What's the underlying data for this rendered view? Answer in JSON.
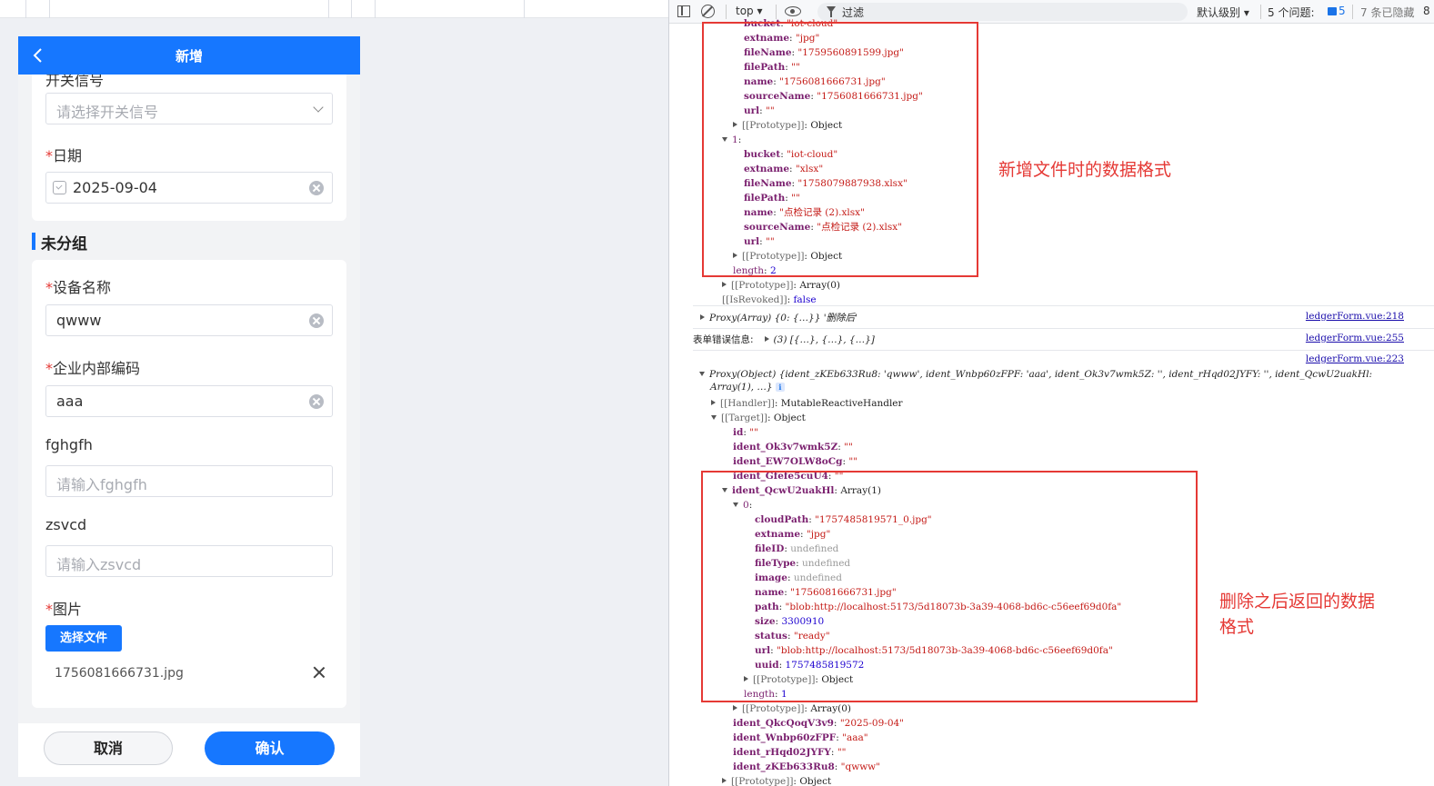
{
  "form": {
    "nav_title": "新增",
    "switch_label_partial": "开关信号",
    "switch_placeholder": "请选择开关信号",
    "date_label": "日期",
    "date_value": "2025-09-04",
    "group_title": "未分组",
    "device_name_label": "设备名称",
    "device_name_value": "qwww",
    "code_label": "企业内部编码",
    "code_value": "aaa",
    "field3_label": "fghgfh",
    "field3_placeholder": "请输入fghgfh",
    "field4_label": "zsvcd",
    "field4_placeholder": "请输入zsvcd",
    "image_label": "图片",
    "upload_label": "选择文件",
    "file_name": "1756081666731.jpg",
    "required_mark": "*",
    "cancel_label": "取消",
    "confirm_label": "确认"
  },
  "devtools": {
    "context": "top ▾",
    "filter_placeholder": "过滤",
    "level": "默认级别 ▾",
    "issues": "5 个问题:",
    "issues_count": "5",
    "hidden": "7 条已隐藏",
    "hidden_tail": "8"
  },
  "console": {
    "block1": [
      {
        "t": "bucket",
        "v": "\"iot-cloud\""
      },
      {
        "t": "extname",
        "v": "\"jpg\""
      },
      {
        "t": "fileName",
        "v": "\"1759560891599.jpg\""
      },
      {
        "t": "filePath",
        "v": "\"\""
      },
      {
        "t": "name",
        "v": "\"1756081666731.jpg\""
      },
      {
        "t": "sourceName",
        "v": "\"1756081666731.jpg\""
      },
      {
        "t": "url",
        "v": "\"\""
      },
      {
        "t": "[[Prototype]]",
        "v": "Object"
      },
      {
        "t": "1",
        "v": ""
      },
      {
        "t": "bucket",
        "v": "\"iot-cloud\""
      },
      {
        "t": "extname",
        "v": "\"xlsx\""
      },
      {
        "t": "fileName",
        "v": "\"1758079887938.xlsx\""
      },
      {
        "t": "filePath",
        "v": "\"\""
      },
      {
        "t": "name",
        "v": "\"点检记录 (2).xlsx\""
      },
      {
        "t": "sourceName",
        "v": "\"点检记录 (2).xlsx\""
      },
      {
        "t": "url",
        "v": "\"\""
      },
      {
        "t": "[[Prototype]]",
        "v": "Object"
      },
      {
        "t": "length",
        "v": "2"
      },
      {
        "t": "[[Prototype]]",
        "v": "Array(0)"
      },
      {
        "t": "[[IsRevoked]]",
        "v": "false"
      }
    ],
    "msg2_text": "Proxy(Array) {0: {…}} '删除后'",
    "msg2_link": "ledgerForm.vue:218",
    "msg3_label": "表单错误信息:",
    "msg3_text": "(3) [{…}, {…}, {…}]",
    "msg3_link": "ledgerForm.vue:255",
    "msg4_link": "ledgerForm.vue:223",
    "msg4_head": "Proxy(Object) {ident_zKEb633Ru8: 'qwww', ident_Wnbp60zFPF: 'aaa', ident_Ok3v7wmk5Z: '', ident_rHqd02JYFY: '', ident_QcwU2uakHl:",
    "msg4_head2": "Array(1), …}",
    "block2": [
      {
        "t": "[[Handler]]",
        "v": "MutableReactiveHandler"
      },
      {
        "t": "[[Target]]",
        "v": "Object"
      },
      {
        "t": "id",
        "v": "\"\""
      },
      {
        "t": "ident_Ok3v7wmk5Z",
        "v": "\"\""
      },
      {
        "t": "ident_EW7OLW8oCg",
        "v": "\"\""
      },
      {
        "t": "ident_Gfefe5cuU4",
        "v": "\"\""
      },
      {
        "t": "ident_QcwU2uakHl",
        "v": "Array(1)"
      },
      {
        "t": "0",
        "v": ""
      },
      {
        "t": "cloudPath",
        "v": "\"1757485819571_0.jpg\""
      },
      {
        "t": "extname",
        "v": "\"jpg\""
      },
      {
        "t": "fileID",
        "v": "undefined"
      },
      {
        "t": "fileType",
        "v": "undefined"
      },
      {
        "t": "image",
        "v": "undefined"
      },
      {
        "t": "name",
        "v": "\"1756081666731.jpg\""
      },
      {
        "t": "path",
        "v": "\"blob:http://localhost:5173/5d18073b-3a39-4068-bd6c-c56eef69d0fa\""
      },
      {
        "t": "size",
        "v": "3300910"
      },
      {
        "t": "status",
        "v": "\"ready\""
      },
      {
        "t": "url",
        "v": "\"blob:http://localhost:5173/5d18073b-3a39-4068-bd6c-c56eef69d0fa\""
      },
      {
        "t": "uuid",
        "v": "1757485819572"
      },
      {
        "t": "[[Prototype]]",
        "v": "Object"
      },
      {
        "t": "length",
        "v": "1"
      },
      {
        "t": "[[Prototype]]",
        "v": "Array(0)"
      },
      {
        "t": "ident_QkcQoqV3v9",
        "v": "\"2025-09-04\""
      },
      {
        "t": "ident_Wnbp60zFPF",
        "v": "\"aaa\""
      },
      {
        "t": "ident_rHqd02JYFY",
        "v": "\"\""
      },
      {
        "t": "ident_zKEb633Ru8",
        "v": "\"qwww\""
      },
      {
        "t": "[[Prototype]]",
        "v": "Object"
      }
    ],
    "anno1": "新增文件时的数据格式",
    "anno2_line1": "删除之后返回的数据",
    "anno2_line2": "格式"
  }
}
